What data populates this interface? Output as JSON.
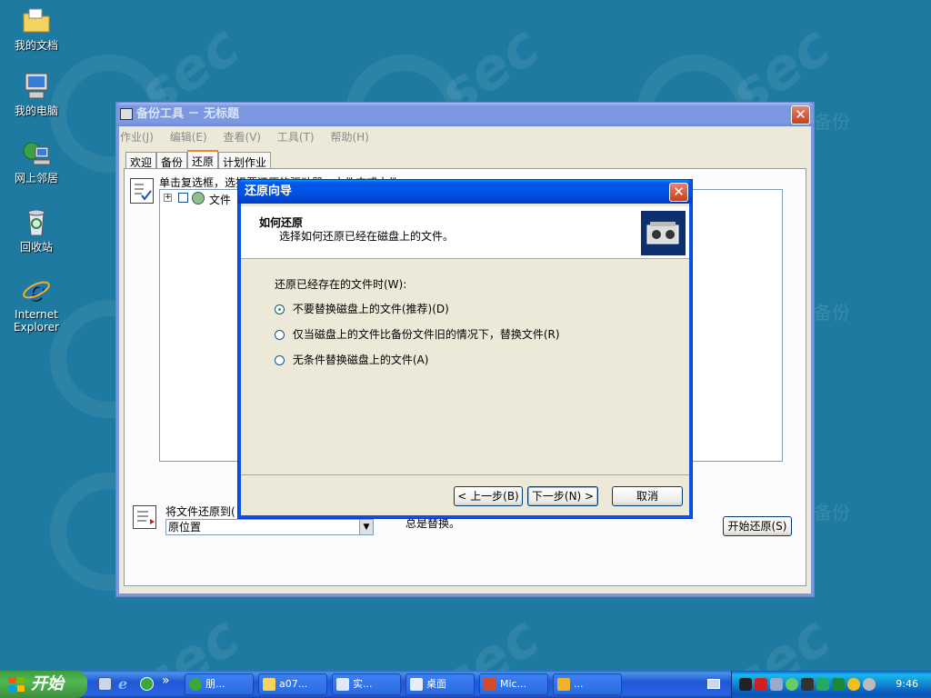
{
  "desktop": {
    "icons": [
      {
        "label": "我的文档"
      },
      {
        "label": "我的电脑"
      },
      {
        "label": "网上邻居"
      },
      {
        "label": "回收站"
      },
      {
        "label_line1": "Internet",
        "label_line2": "Explorer"
      }
    ],
    "watermark_text": "sec",
    "watermark_sub": "备份"
  },
  "backup_window": {
    "title": "备份工具 － 无标题",
    "menus": [
      "作业(J)",
      "编辑(E)",
      "查看(V)",
      "工具(T)",
      "帮助(H)"
    ],
    "tabs": [
      "欢迎",
      "备份",
      "还原",
      "计划作业"
    ],
    "active_tab": "还原",
    "instruction": "单击复选框，选择要还原的驱动器，文件夹或文件",
    "tree_item": "文件",
    "restore_to_label": "将文件还原到(",
    "restore_to_value": "原位置",
    "replace_note": "总是替换。",
    "start_restore_button": "开始还原(S)"
  },
  "wizard": {
    "title": "还原向导",
    "header_title": "如何还原",
    "header_subtitle": "选择如何还原已经在磁盘上的文件。",
    "group_label": "还原已经存在的文件时(W):",
    "options": [
      {
        "label": "不要替换磁盘上的文件(推荐)(D)",
        "checked": true
      },
      {
        "label": "仅当磁盘上的文件比备份文件旧的情况下，替换文件(R)",
        "checked": false
      },
      {
        "label": "无条件替换磁盘上的文件(A)",
        "checked": false
      }
    ],
    "back_button": "< 上一步(B)",
    "next_button": "下一步(N) >",
    "cancel_button": "取消"
  },
  "taskbar": {
    "start_label": "开始",
    "chevron": "»",
    "tasks": [
      "朋...",
      "a07...",
      "实...",
      "桌面",
      "Mic...",
      "..."
    ],
    "clock": "9:46"
  }
}
